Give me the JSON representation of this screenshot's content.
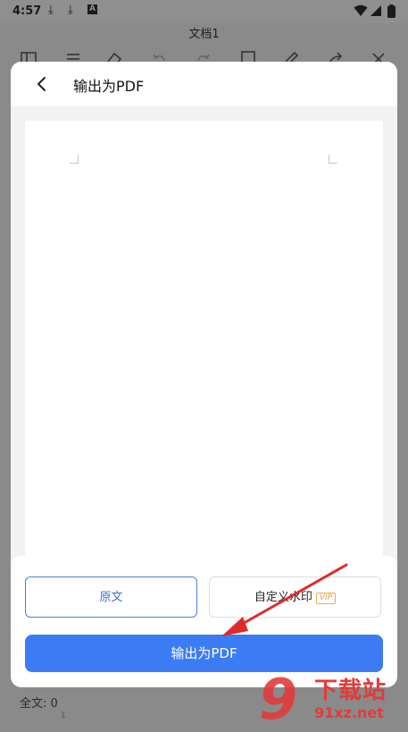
{
  "status_bar": {
    "time": "4:57",
    "download_icon": "⤓",
    "accessibility_letter": "A"
  },
  "app_bar": {
    "title": "文档1"
  },
  "dialog": {
    "title": "输出为PDF",
    "options": {
      "original_label": "原文",
      "watermark_label": "自定义水印",
      "vip_label": "VIP"
    },
    "export_label": "输出为PDF"
  },
  "footer": {
    "word_count": "全文: 0",
    "tick": "1"
  },
  "watermark_logo": {
    "digit": "9",
    "site_name": "下载站",
    "url": "91xz.net"
  },
  "colors": {
    "accent_blue": "#3b7cf5",
    "annotation_red": "#e02a2a",
    "vip_gold": "#e0a23a"
  }
}
